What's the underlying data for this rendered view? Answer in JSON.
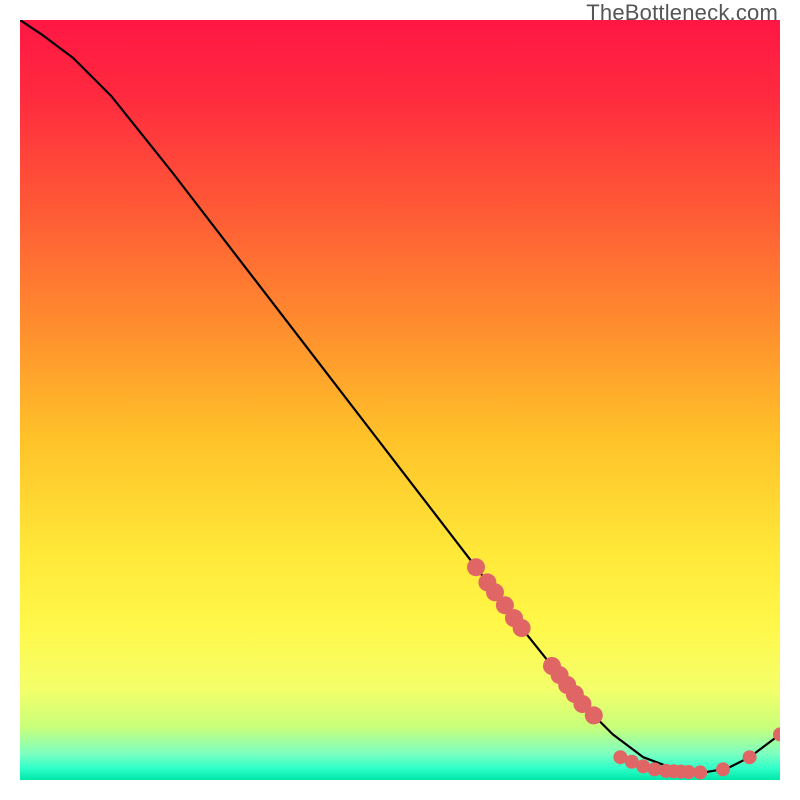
{
  "watermark": "TheBottleneck.com",
  "chart_data": {
    "type": "line",
    "title": "",
    "xlabel": "",
    "ylabel": "",
    "xlim": [
      0,
      100
    ],
    "ylim": [
      0,
      100
    ],
    "background_gradient": {
      "stops": [
        {
          "offset": 0.0,
          "color": "#ff1744"
        },
        {
          "offset": 0.1,
          "color": "#ff2a3f"
        },
        {
          "offset": 0.25,
          "color": "#ff5a36"
        },
        {
          "offset": 0.4,
          "color": "#ff8c2e"
        },
        {
          "offset": 0.55,
          "color": "#ffc229"
        },
        {
          "offset": 0.7,
          "color": "#ffe838"
        },
        {
          "offset": 0.8,
          "color": "#fff84a"
        },
        {
          "offset": 0.88,
          "color": "#f4ff6a"
        },
        {
          "offset": 0.93,
          "color": "#c9ff7a"
        },
        {
          "offset": 0.965,
          "color": "#7dffc0"
        },
        {
          "offset": 0.985,
          "color": "#2effc9"
        },
        {
          "offset": 1.0,
          "color": "#00e6a8"
        }
      ]
    },
    "series": [
      {
        "name": "bottleneck-curve",
        "x": [
          0,
          3,
          7,
          12,
          20,
          30,
          40,
          50,
          60,
          66,
          70,
          74,
          78,
          82,
          86,
          90,
          93,
          96,
          100
        ],
        "y": [
          100,
          98,
          95,
          90,
          80,
          67,
          54,
          41,
          28,
          20,
          15,
          10,
          6,
          3,
          1.5,
          1,
          1.5,
          3,
          6
        ]
      }
    ],
    "markers": {
      "cluster_along_curve": [
        {
          "x": 60.0,
          "y": 28.0
        },
        {
          "x": 61.5,
          "y": 26.0
        },
        {
          "x": 62.5,
          "y": 24.7
        },
        {
          "x": 63.8,
          "y": 23.0
        },
        {
          "x": 65.0,
          "y": 21.3
        },
        {
          "x": 66.0,
          "y": 20.0
        },
        {
          "x": 70.0,
          "y": 15.0
        },
        {
          "x": 71.0,
          "y": 13.8
        },
        {
          "x": 72.0,
          "y": 12.5
        },
        {
          "x": 73.0,
          "y": 11.3
        },
        {
          "x": 74.0,
          "y": 10.0
        },
        {
          "x": 75.5,
          "y": 8.5
        }
      ],
      "cluster_bottom": [
        {
          "x": 79.0,
          "y": 3.0
        },
        {
          "x": 80.5,
          "y": 2.4
        },
        {
          "x": 82.0,
          "y": 1.8
        },
        {
          "x": 83.5,
          "y": 1.4
        },
        {
          "x": 85.0,
          "y": 1.2
        },
        {
          "x": 86.0,
          "y": 1.15
        },
        {
          "x": 87.0,
          "y": 1.1
        },
        {
          "x": 88.0,
          "y": 1.05
        },
        {
          "x": 89.5,
          "y": 1.0
        },
        {
          "x": 92.5,
          "y": 1.4
        },
        {
          "x": 96.0,
          "y": 3.0
        }
      ],
      "top_right_point": [
        {
          "x": 100.0,
          "y": 6.0
        }
      ]
    },
    "marker_style": {
      "color": "#e06666",
      "radius_large": 9,
      "radius_small": 7
    }
  }
}
